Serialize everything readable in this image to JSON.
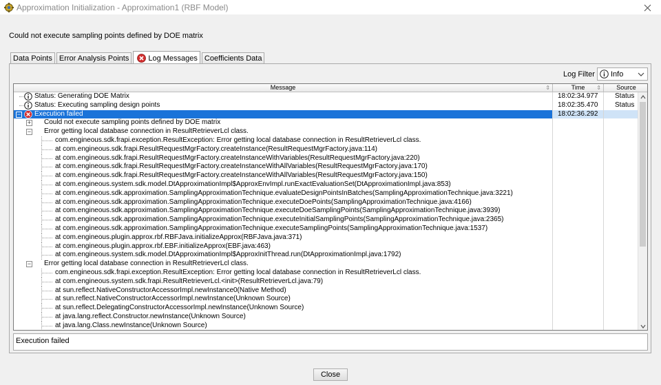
{
  "window": {
    "title": "Approximation Initialization - Approximation1 (RBF Model)"
  },
  "headline": "Could not execute sampling points defined by DOE matrix",
  "tabs": [
    {
      "label": "Data Points",
      "active": false
    },
    {
      "label": "Error Analysis Points",
      "active": false
    },
    {
      "label": "Log Messages",
      "active": true,
      "icon": "error-icon"
    },
    {
      "label": "Coefficients Data",
      "active": false
    }
  ],
  "log_filter": {
    "label": "Log Filter",
    "selected": "Info",
    "icon": "info-icon"
  },
  "table": {
    "columns": [
      "Message",
      "Time",
      "Source"
    ],
    "rows": [
      {
        "level": 0,
        "icon": "info-icon",
        "toggle": "",
        "text": "Status: Generating DOE Matrix",
        "time": "18:02:34.977",
        "source": "Status"
      },
      {
        "level": 0,
        "icon": "info-icon",
        "toggle": "",
        "text": "Status: Executing sampling design points",
        "time": "18:02:35.470",
        "source": "Status"
      },
      {
        "level": 0,
        "icon": "error-icon",
        "toggle": "−",
        "text": "Execution failed",
        "time": "18:02:36.292",
        "source": "",
        "selected": true
      },
      {
        "level": 1,
        "icon": "",
        "toggle": "+",
        "text": "Could not execute sampling points defined by DOE matrix",
        "time": "",
        "source": ""
      },
      {
        "level": 1,
        "icon": "",
        "toggle": "−",
        "text": "Error getting local database connection in ResultRetrieverLcl class.",
        "time": "",
        "source": ""
      },
      {
        "level": 2,
        "icon": "",
        "toggle": "",
        "text": "com.engineous.sdk.frapi.exception.ResultException: Error getting local database connection in ResultRetrieverLcl class.",
        "time": "",
        "source": ""
      },
      {
        "level": 2,
        "icon": "",
        "toggle": "",
        "text": "at com.engineous.sdk.frapi.ResultRequestMgrFactory.createInstance(ResultRequestMgrFactory.java:114)",
        "time": "",
        "source": ""
      },
      {
        "level": 2,
        "icon": "",
        "toggle": "",
        "text": "at com.engineous.sdk.frapi.ResultRequestMgrFactory.createInstanceWithVariables(ResultRequestMgrFactory.java:220)",
        "time": "",
        "source": ""
      },
      {
        "level": 2,
        "icon": "",
        "toggle": "",
        "text": "at com.engineous.sdk.frapi.ResultRequestMgrFactory.createInstanceWithAllVariables(ResultRequestMgrFactory.java:170)",
        "time": "",
        "source": ""
      },
      {
        "level": 2,
        "icon": "",
        "toggle": "",
        "text": "at com.engineous.sdk.frapi.ResultRequestMgrFactory.createInstanceWithAllVariables(ResultRequestMgrFactory.java:150)",
        "time": "",
        "source": ""
      },
      {
        "level": 2,
        "icon": "",
        "toggle": "",
        "text": "at com.engineous.system.sdk.model.DtApproximationImpl$ApproxEnvImpl.runExactEvaluationSet(DtApproximationImpl.java:853)",
        "time": "",
        "source": ""
      },
      {
        "level": 2,
        "icon": "",
        "toggle": "",
        "text": "at com.engineous.sdk.approximation.SamplingApproximationTechnique.evaluateDesignPointsInBatches(SamplingApproximationTechnique.java:3221)",
        "time": "",
        "source": ""
      },
      {
        "level": 2,
        "icon": "",
        "toggle": "",
        "text": "at com.engineous.sdk.approximation.SamplingApproximationTechnique.executeDoePoints(SamplingApproximationTechnique.java:4166)",
        "time": "",
        "source": ""
      },
      {
        "level": 2,
        "icon": "",
        "toggle": "",
        "text": "at com.engineous.sdk.approximation.SamplingApproximationTechnique.executeDoeSamplingPoints(SamplingApproximationTechnique.java:3939)",
        "time": "",
        "source": ""
      },
      {
        "level": 2,
        "icon": "",
        "toggle": "",
        "text": "at com.engineous.sdk.approximation.SamplingApproximationTechnique.executeInitialSamplingPoints(SamplingApproximationTechnique.java:2365)",
        "time": "",
        "source": ""
      },
      {
        "level": 2,
        "icon": "",
        "toggle": "",
        "text": "at com.engineous.sdk.approximation.SamplingApproximationTechnique.executeSamplingPoints(SamplingApproximationTechnique.java:1537)",
        "time": "",
        "source": ""
      },
      {
        "level": 2,
        "icon": "",
        "toggle": "",
        "text": "at com.engineous.plugin.approx.rbf.RBFJava.initializeApprox(RBFJava.java:371)",
        "time": "",
        "source": ""
      },
      {
        "level": 2,
        "icon": "",
        "toggle": "",
        "text": "at com.engineous.plugin.approx.rbf.EBF.initializeApprox(EBF.java:463)",
        "time": "",
        "source": ""
      },
      {
        "level": 2,
        "icon": "",
        "toggle": "",
        "text": "at com.engineous.system.sdk.model.DtApproximationImpl$ApproxInitThread.run(DtApproximationImpl.java:1792)",
        "time": "",
        "source": ""
      },
      {
        "level": 1,
        "icon": "",
        "toggle": "−",
        "text": "Error getting local database connection in ResultRetrieverLcl class.",
        "time": "",
        "source": ""
      },
      {
        "level": 2,
        "icon": "",
        "toggle": "",
        "text": "com.engineous.sdk.frapi.exception.ResultException: Error getting local database connection in ResultRetrieverLcl class.",
        "time": "",
        "source": ""
      },
      {
        "level": 2,
        "icon": "",
        "toggle": "",
        "text": "at com.engineous.system.sdk.frapi.ResultRetrieverLcl.<init>(ResultRetrieverLcl.java:79)",
        "time": "",
        "source": ""
      },
      {
        "level": 2,
        "icon": "",
        "toggle": "",
        "text": "at sun.reflect.NativeConstructorAccessorImpl.newInstance0(Native Method)",
        "time": "",
        "source": ""
      },
      {
        "level": 2,
        "icon": "",
        "toggle": "",
        "text": "at sun.reflect.NativeConstructorAccessorImpl.newInstance(Unknown Source)",
        "time": "",
        "source": ""
      },
      {
        "level": 2,
        "icon": "",
        "toggle": "",
        "text": "at sun.reflect.DelegatingConstructorAccessorImpl.newInstance(Unknown Source)",
        "time": "",
        "source": ""
      },
      {
        "level": 2,
        "icon": "",
        "toggle": "",
        "text": "at java.lang.reflect.Constructor.newInstance(Unknown Source)",
        "time": "",
        "source": ""
      },
      {
        "level": 2,
        "icon": "",
        "toggle": "",
        "text": "at java.lang.Class.newInstance(Unknown Source)",
        "time": "",
        "source": ""
      }
    ]
  },
  "detail_text": "Execution failed",
  "buttons": {
    "close": "Close"
  },
  "colors": {
    "selection": "#1a73d9",
    "error": "#d32f2f",
    "title_text": "#8a8a8a"
  }
}
